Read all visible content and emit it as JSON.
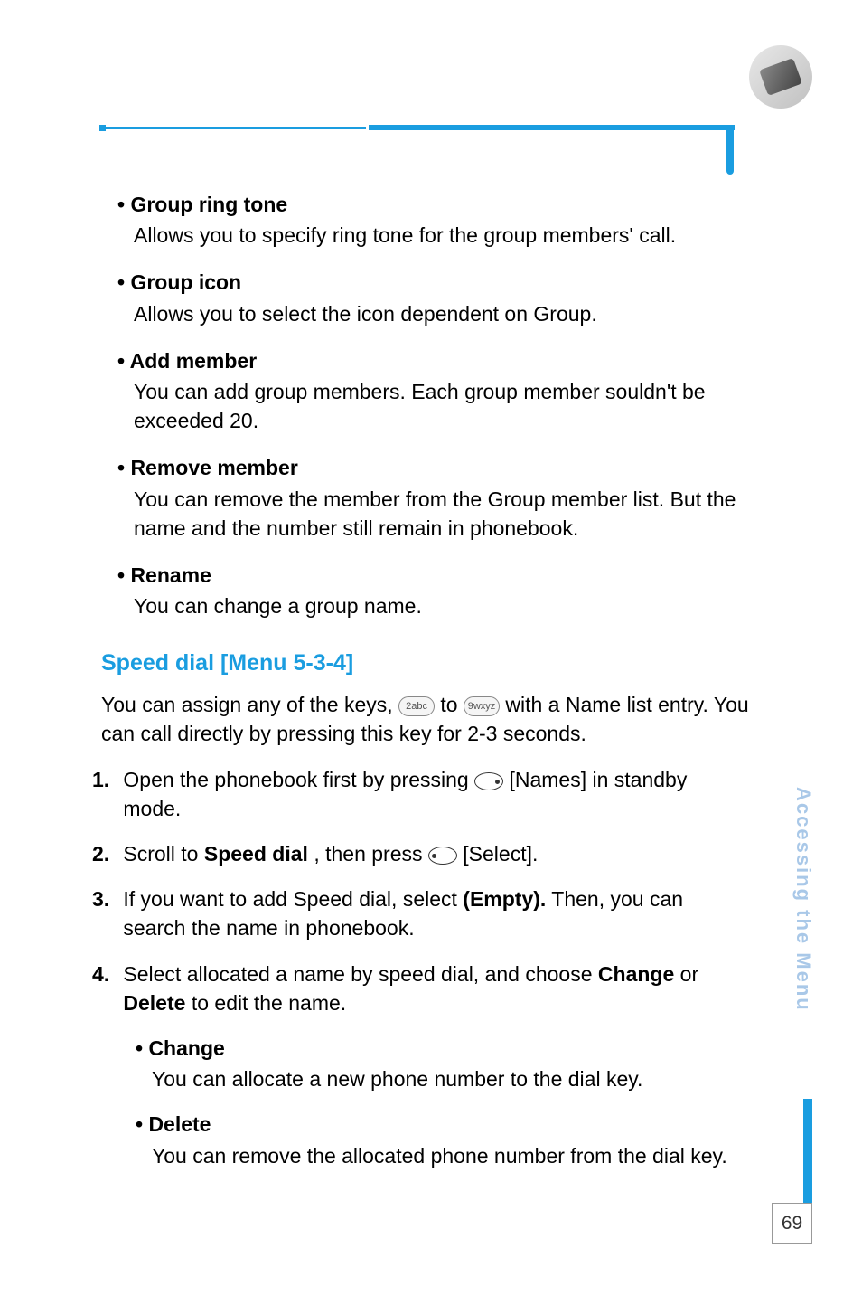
{
  "header": {
    "icon": "phone-icon"
  },
  "bullets": [
    {
      "title": "• Group ring tone",
      "body": "Allows you to specify ring tone for the group members' call."
    },
    {
      "title": "• Group icon",
      "body": "Allows you to select the icon dependent on Group."
    },
    {
      "title": "• Add member",
      "body": "You can add group members. Each group member souldn't be exceeded 20."
    },
    {
      "title": "• Remove member",
      "body": "You can remove the member from the Group member list. But the name and the number still remain in phonebook."
    },
    {
      "title": "• Rename",
      "body": "You can change a group name."
    }
  ],
  "section": {
    "title": "Speed dial [Menu 5-3-4]",
    "intro_pre": "You can assign any of the keys, ",
    "intro_mid": " to ",
    "intro_post": " with a Name list entry. You can call directly by pressing this key for 2-3 seconds.",
    "key2": "2abc",
    "key9": "9wxyz"
  },
  "steps": [
    {
      "num": "1.",
      "pre": "Open the phonebook first by pressing ",
      "post": " [Names] in standby mode."
    },
    {
      "num": "2.",
      "pre": "Scroll to ",
      "bold1": "Speed dial",
      "mid": ", then press ",
      "post": " [Select]."
    },
    {
      "num": "3.",
      "pre": "If you want to add Speed dial, select ",
      "bold1": "(Empty).",
      "post": " Then, you can search the name in phonebook."
    },
    {
      "num": "4.",
      "pre": "Select allocated a name by speed dial, and choose ",
      "bold1": "Change",
      "mid": " or ",
      "bold2": "Delete",
      "post": " to edit the name."
    }
  ],
  "subbullets": [
    {
      "title": "• Change",
      "body": "You can allocate a new phone number to the dial key."
    },
    {
      "title": "• Delete",
      "body": "You can remove the allocated phone number from the dial key."
    }
  ],
  "sidebar": {
    "label": "Accessing the Menu"
  },
  "page": {
    "number": "69"
  }
}
